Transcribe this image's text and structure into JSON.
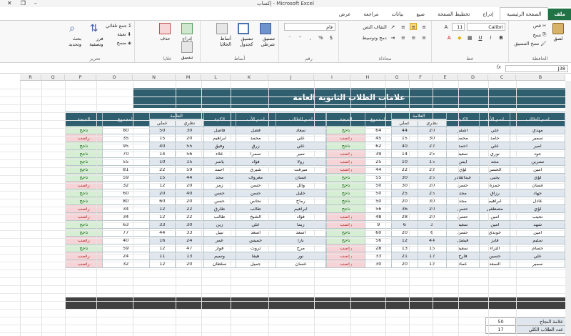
{
  "window": {
    "title": "إكساب - Microsoft Excel"
  },
  "ribbon_tabs": [
    "ملف",
    "الصفحة الرئيسية",
    "إدراج",
    "تخطيط الصفحة",
    "صيغ",
    "بيانات",
    "مراجعة",
    "عرض"
  ],
  "ribbon": {
    "clipboard": {
      "label": "الحافظة",
      "paste": "لصق",
      "cut": "قص",
      "copy": "نسخ",
      "format_painter": "نسخ التنسيق"
    },
    "font": {
      "label": "خط",
      "font_name": "Calibri",
      "font_size": "11",
      "bold": "B",
      "italic": "I",
      "underline": "U"
    },
    "alignment": {
      "label": "محاذاة",
      "wrap": "التفاف النص",
      "merge": "دمج وتوسيط"
    },
    "number": {
      "label": "رقم",
      "format": "عام",
      "percent": "%",
      "comma": ","
    },
    "styles": {
      "label": "أنماط",
      "conditional": "تنسيق شرطي",
      "as_table": "تنسيق كجدول",
      "cell_styles": "أنماط الخلايا"
    },
    "cells": {
      "label": "خلايا",
      "insert": "إدراج",
      "delete": "حذف",
      "format": "تنسيق"
    },
    "editing": {
      "label": "تحرير",
      "autosum": "جمع تلقائي",
      "fill": "تعبئة",
      "clear": "مسح",
      "sort": "فرز وتصفية",
      "find": "بحث وتحديد"
    }
  },
  "formula_bar": {
    "name_box": "J38",
    "fx": "fx",
    "content": ""
  },
  "columns": [
    "B",
    "C",
    "D",
    "E",
    "F",
    "G",
    "H",
    "I",
    "J",
    "K",
    "L",
    "M",
    "N",
    "O",
    "P",
    "Q",
    "R"
  ],
  "sheet": {
    "title": "علامات الطلاب الثانوية العامة",
    "headers": {
      "student": "اسم الطالب",
      "father": "اسم الأب",
      "family": "الكنية",
      "mark": "العلامة",
      "theory": "نظري",
      "practical": "عملي",
      "total": "المجموع",
      "result": "النتيجة"
    },
    "right_rows": [
      [
        "مهدي",
        "علي",
        "اشقر",
        "20",
        "44",
        "64",
        "ناجح"
      ],
      [
        "سمير",
        "حامد",
        "محمد",
        "30",
        "15",
        "45",
        "راسب"
      ],
      [
        "امير",
        "علي",
        "احمد",
        "22",
        "40",
        "62",
        "ناجح"
      ],
      [
        "جود",
        "نوري",
        "سعيد",
        "25",
        "14",
        "39",
        "راسب"
      ],
      [
        "نسرين",
        "مجد",
        "ايمن",
        "15",
        "10",
        "25",
        "راسب"
      ],
      [
        "امين",
        "الحسن",
        "لؤي",
        "22",
        "22",
        "44",
        "راسب"
      ],
      [
        "لؤي",
        "يحيى",
        "عبدالقادر",
        "25",
        "30",
        "55",
        "ناجح"
      ],
      [
        "غسان",
        "حمزة",
        "حسن",
        "20",
        "30",
        "50",
        "ناجح"
      ],
      [
        "جهاد",
        "رزاق",
        "مجد",
        "25",
        "25",
        "50",
        "ناجح"
      ],
      [
        "عادل",
        "ابراهيم",
        "مجد",
        "30",
        "20",
        "50",
        "ناجح"
      ],
      [
        "لؤي",
        "مصطفى",
        "حسن",
        "20",
        "36",
        "56",
        "ناجح"
      ],
      [
        "نجيب",
        "امين",
        "حسن",
        "20",
        "28",
        "48",
        "راسب"
      ],
      [
        "شهد",
        "امين",
        "سعيد",
        "3",
        "6",
        "9",
        "راسب"
      ],
      [
        "امين",
        "خوندي",
        "حسن",
        "6",
        "20",
        "60",
        "ناجح"
      ],
      [
        "سليم",
        "فايز",
        "فيصل",
        "44",
        "12",
        "56",
        "ناجح"
      ],
      [
        "حسام",
        "التزاء",
        "سعيد",
        "15",
        "13",
        "28",
        "راسب"
      ],
      [
        "علي",
        "حسين",
        "فارح",
        "12",
        "21",
        "33",
        "راسب"
      ],
      [
        "سمير",
        "السعد",
        "عماد",
        "12",
        "20",
        "30",
        "راسب"
      ]
    ],
    "left_rows": [
      [
        "سعاد",
        "فضل",
        "فاضل",
        "30",
        "50",
        "80",
        "ناجح"
      ],
      [
        "علي",
        "محمد",
        "ابراهيم",
        "20",
        "15",
        "35",
        "راسب"
      ],
      [
        "علي",
        "زرق",
        "وفيق",
        "55",
        "40",
        "95",
        "ناجح"
      ],
      [
        "سير",
        "سمرا",
        "علاء",
        "56",
        "14",
        "70",
        "ناجح"
      ],
      [
        "رولا",
        "فؤاد",
        "ياسر",
        "15",
        "10",
        "55",
        "ناجح"
      ],
      [
        "ميرفت",
        "شيري",
        "احمد",
        "59",
        "22",
        "81",
        "ناجح"
      ],
      [
        "غسان",
        "معروف",
        "مجد",
        "44",
        "15",
        "59",
        "ناجح"
      ],
      [
        "وائل",
        "حسن",
        "زمز",
        "20",
        "12",
        "32",
        "راسب"
      ],
      [
        "خليل",
        "حسن",
        "حسن",
        "40",
        "20",
        "60",
        "ناجح"
      ],
      [
        "رماح",
        "نحاس",
        "حسن",
        "20",
        "60",
        "80",
        "ناجح"
      ],
      [
        "ابراهيم",
        "طالب",
        "طارق",
        "22",
        "12",
        "34",
        "راسب"
      ],
      [
        "فؤاد",
        "الشيخ",
        "طالب",
        "22",
        "12",
        "34",
        "راسب"
      ],
      [
        "زيما",
        "علي",
        "زين",
        "30",
        "33",
        "63",
        "ناجح"
      ],
      [
        "اسعد",
        "اسعد",
        "نبيل",
        "33",
        "44",
        "77",
        "ناجح"
      ],
      [
        "بارا",
        "خميس",
        "عمر",
        "24",
        "16",
        "40",
        "راسب"
      ],
      [
        "مرح",
        "ثروت",
        "فواز",
        "47",
        "12",
        "59",
        "ناجح"
      ],
      [
        "نور",
        "هيفا",
        "وسيم",
        "13",
        "11",
        "24",
        "راسب"
      ],
      [
        "غسان",
        "جميل",
        "سلطان",
        "20",
        "12",
        "32",
        "راسب"
      ]
    ],
    "stats": [
      {
        "label": "علامة النجاح",
        "value": "50"
      },
      {
        "label": "عدد الطلاب الكلي",
        "value": "17"
      }
    ]
  }
}
